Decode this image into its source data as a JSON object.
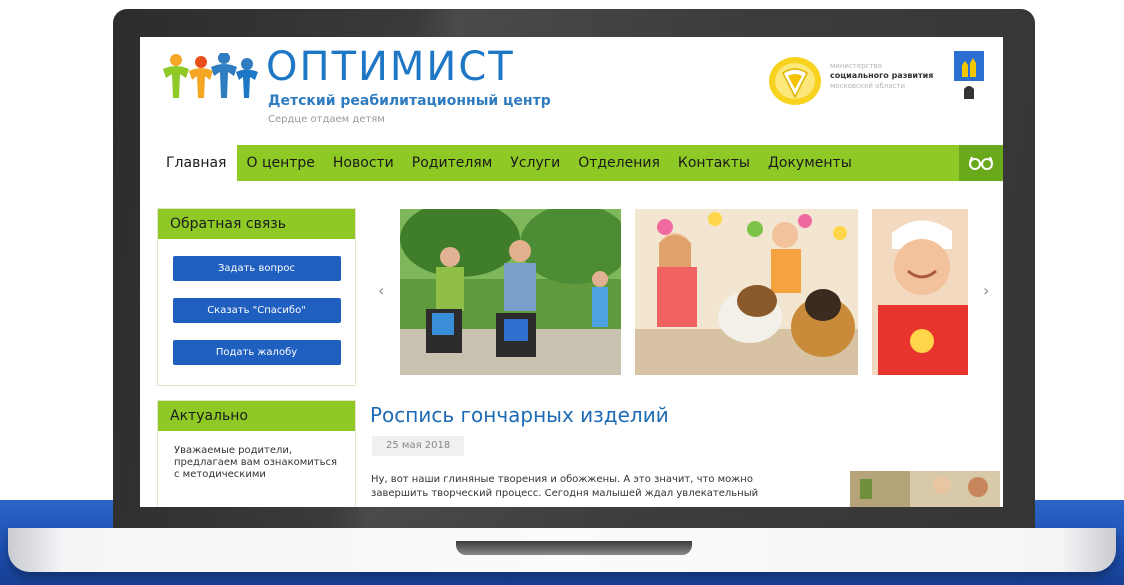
{
  "site": {
    "brand": "ОПТИМИСТ",
    "subtitle": "Детский реабилитационный центр",
    "motto": "Сердце отдаем детям"
  },
  "ministry": {
    "line1": "министерство",
    "line2": "социального развития",
    "line3": "московской области"
  },
  "nav": {
    "items": [
      {
        "label": "Главная",
        "active": true
      },
      {
        "label": "О центре"
      },
      {
        "label": "Новости"
      },
      {
        "label": "Родителям"
      },
      {
        "label": "Услуги"
      },
      {
        "label": "Отделения"
      },
      {
        "label": "Контакты"
      },
      {
        "label": "Документы"
      }
    ],
    "accessibility_icon": "glasses-icon"
  },
  "feedback": {
    "title": "Обратная связь",
    "buttons": [
      "Задать вопрос",
      "Сказать \"Спасибо\"",
      "Подать жалобу"
    ]
  },
  "actual": {
    "title": "Актуально",
    "text": "Уважаемые родители, предлагаем вам ознакомиться с методическими"
  },
  "slider": {
    "prev_icon": "chevron-left-icon",
    "next_icon": "chevron-right-icon",
    "prev_glyph": "‹",
    "next_glyph": "›"
  },
  "article": {
    "title": "Роспись гончарных изделий",
    "date": "25 мая 2018",
    "text": "Ну, вот наши глиняные творения и обожжены. А это значит, что можно завершить творческий процесс. Сегодня малышей ждал увлекательный"
  },
  "colors": {
    "accent_green": "#8fc926",
    "brand_blue": "#1e77c4",
    "button_blue": "#1f5fbf",
    "laptop_frame": "#3a3a3a",
    "background_band": "#1d4fb0"
  }
}
